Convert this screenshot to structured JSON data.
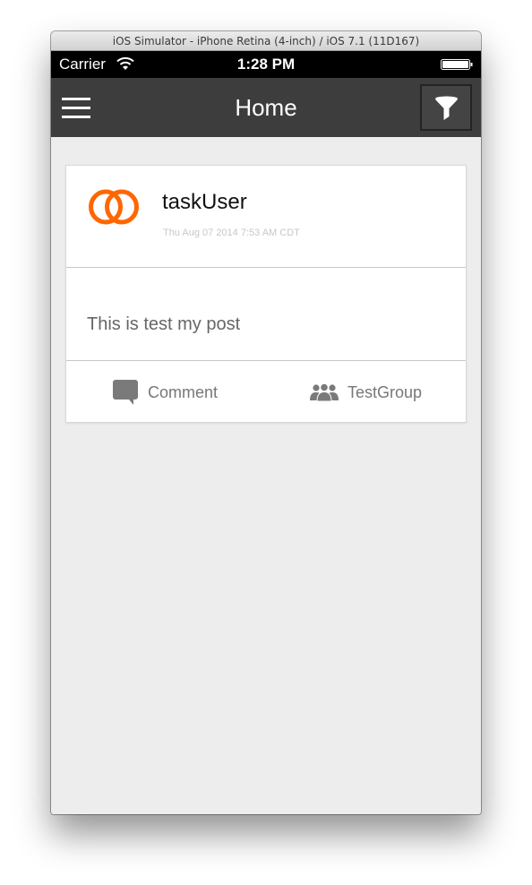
{
  "window": {
    "title": "iOS Simulator - iPhone Retina (4-inch) / iOS 7.1 (11D167)"
  },
  "status_bar": {
    "carrier": "Carrier",
    "time": "1:28 PM",
    "icons": [
      "wifi-icon",
      "battery-icon"
    ]
  },
  "nav_bar": {
    "title": "Home",
    "left_icon": "menu-icon",
    "right_icon": "filter-icon",
    "background_color": "#3d3d3d"
  },
  "post": {
    "username": "taskUser",
    "timestamp": "Thu Aug 07 2014 7:53 AM CDT",
    "text": "This is test my post",
    "avatar_icon": "interlocking-rings-logo",
    "avatar_color": "#ff6600",
    "actions": {
      "comment_label": "Comment",
      "comment_icon": "comment-bubble-icon",
      "group_label": "TestGroup",
      "group_icon": "group-users-icon"
    }
  }
}
